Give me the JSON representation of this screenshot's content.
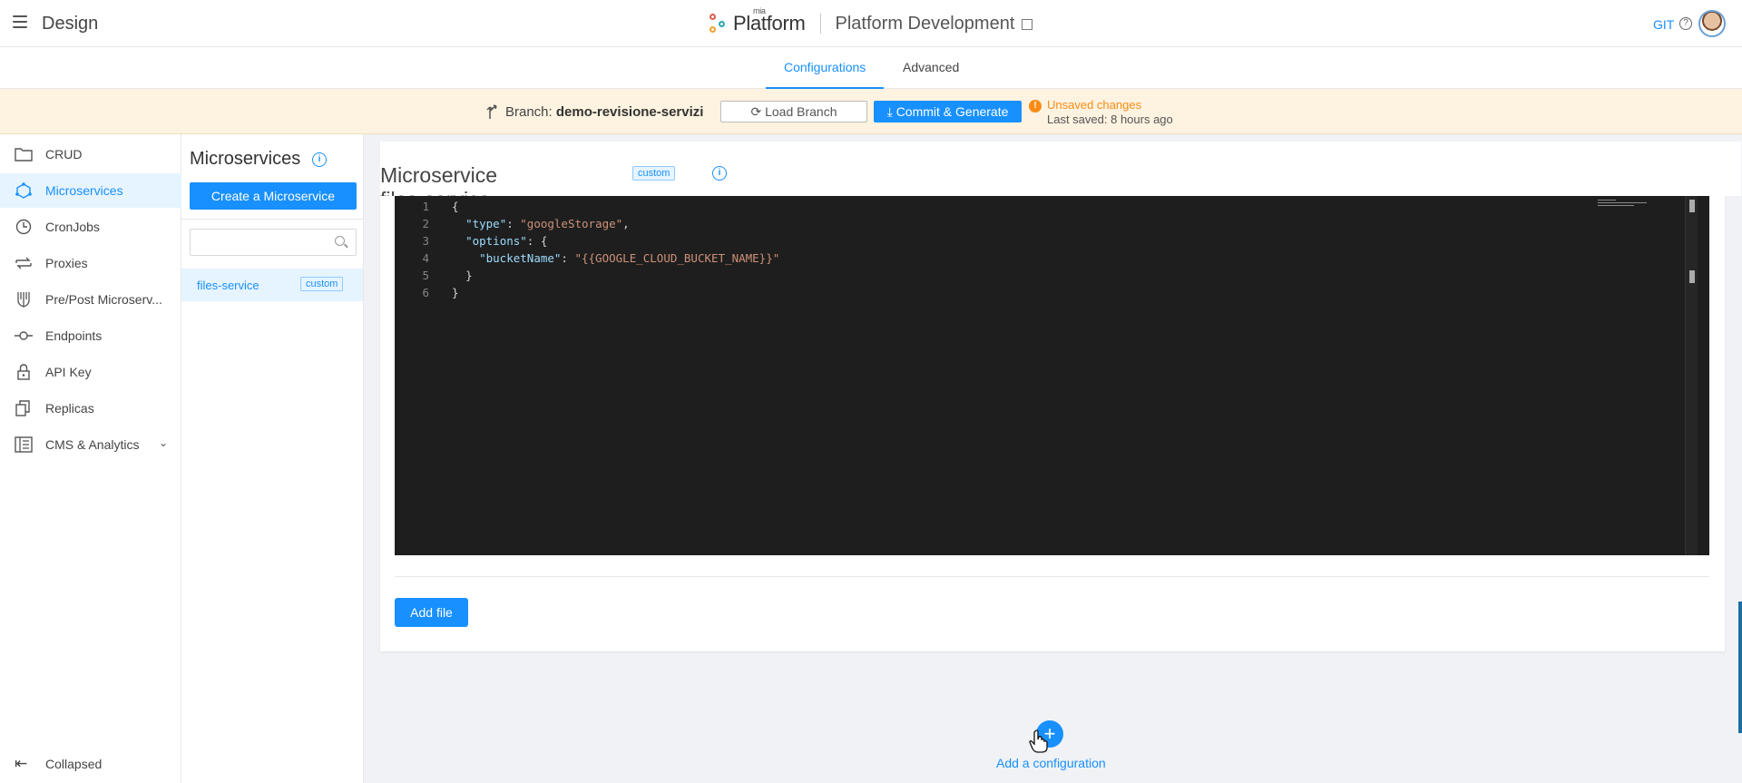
{
  "header": {
    "app_title": "Design",
    "logo_small": "mia",
    "logo_text": "Platform",
    "project_name": "Platform Development",
    "git_label": "GIT",
    "help_glyph": "?"
  },
  "tabs": [
    {
      "label": "Configurations",
      "active": true
    },
    {
      "label": "Advanced",
      "active": false
    }
  ],
  "branch_bar": {
    "prefix": "Branch:",
    "branch_name": "demo-revisione-servizi",
    "load_branch_label": "Load Branch",
    "commit_label": "Commit & Generate",
    "warn_glyph": "!",
    "unsaved_label": "Unsaved changes",
    "last_saved_label": "Last saved:  8 hours ago"
  },
  "sidebar": {
    "items": [
      {
        "label": "CRUD",
        "icon": "folder-icon",
        "active": false
      },
      {
        "label": "Microservices",
        "icon": "microservices-icon",
        "active": true
      },
      {
        "label": "CronJobs",
        "icon": "clock-icon",
        "active": false
      },
      {
        "label": "Proxies",
        "icon": "swap-icon",
        "active": false
      },
      {
        "label": "Pre/Post Microserv...",
        "icon": "fork-icon",
        "active": false
      },
      {
        "label": "Endpoints",
        "icon": "endpoint-icon",
        "active": false
      },
      {
        "label": "API Key",
        "icon": "lock-icon",
        "active": false
      },
      {
        "label": "Replicas",
        "icon": "copy-icon",
        "active": false
      },
      {
        "label": "CMS & Analytics",
        "icon": "layout-icon",
        "active": false
      }
    ],
    "collapsed_label": "Collapsed"
  },
  "microservices_panel": {
    "title": "Microservices",
    "create_label": "Create a Microservice",
    "search_placeholder": "",
    "items": [
      {
        "name": "files-service",
        "tag": "custom"
      }
    ]
  },
  "main": {
    "title": "Microservice files-service",
    "tag": "custom",
    "info_glyph": "i",
    "editor_lines": [
      {
        "n": "1",
        "indent": "",
        "key": "",
        "value": "",
        "text": "{"
      },
      {
        "n": "2",
        "indent": "  ",
        "key": "\"type\"",
        "value": "\"googleStorage\"",
        "text": ","
      },
      {
        "n": "3",
        "indent": "  ",
        "key": "\"options\"",
        "value": "",
        "text": ": {"
      },
      {
        "n": "4",
        "indent": "    ",
        "key": "\"bucketName\"",
        "value": "\"{{GOOGLE_CLOUD_BUCKET_NAME}}\"",
        "text": ""
      },
      {
        "n": "5",
        "indent": "  ",
        "key": "",
        "value": "",
        "text": "}"
      },
      {
        "n": "6",
        "indent": "",
        "key": "",
        "value": "",
        "text": "}"
      }
    ],
    "add_file_label": "Add file",
    "add_config_label": "Add a configuration",
    "add_config_glyph": "+"
  },
  "colors": {
    "accent": "#1890ff",
    "warning": "#fa8c16",
    "branch_bar_bg": "#fdf3e0",
    "editor_bg": "#1e1e1e"
  }
}
